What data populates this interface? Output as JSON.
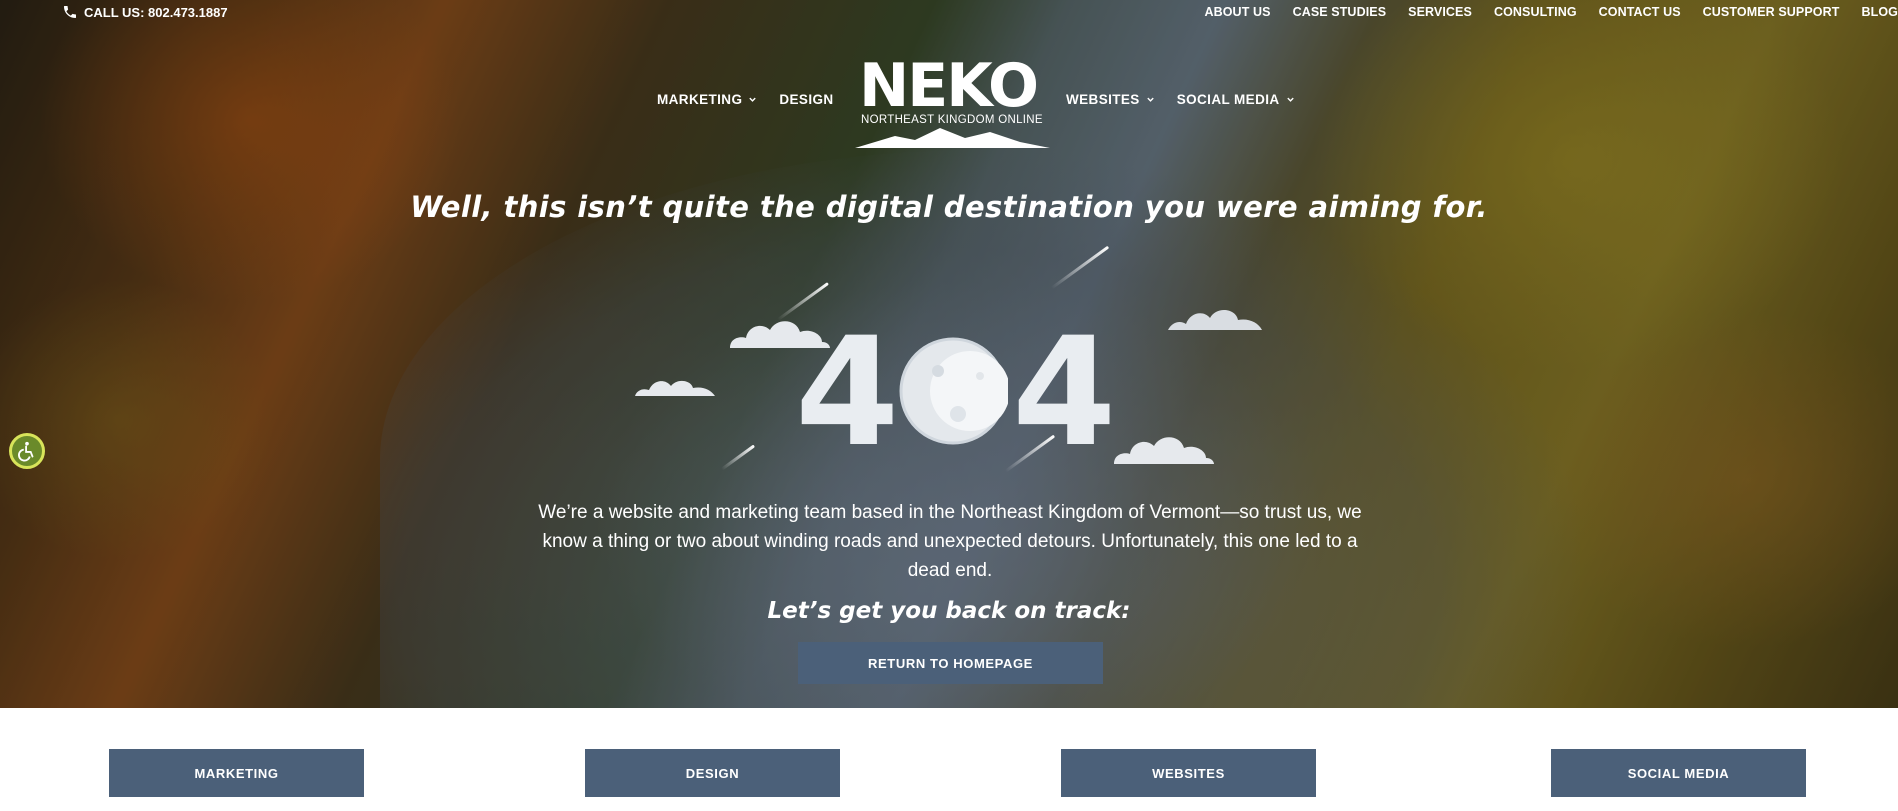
{
  "header": {
    "phone_label": "CALL US: 802.473.1887",
    "top_nav": [
      "ABOUT US",
      "CASE STUDIES",
      "SERVICES",
      "CONSULTING",
      "CONTACT US",
      "CUSTOMER SUPPORT",
      "BLOG"
    ],
    "main_nav_left": [
      {
        "label": "MARKETING",
        "has_dropdown": true
      },
      {
        "label": "DESIGN",
        "has_dropdown": false
      }
    ],
    "main_nav_right": [
      {
        "label": "WEBSITES",
        "has_dropdown": true
      },
      {
        "label": "SOCIAL MEDIA",
        "has_dropdown": true
      }
    ],
    "logo": {
      "word": "NEKO",
      "tagline": "NORTHEAST KINGDOM ONLINE"
    }
  },
  "hero": {
    "headline": "Well, this isn’t quite the digital destination you were aiming for.",
    "error_code": {
      "first": "4",
      "last": "4"
    },
    "description": "We’re a website and marketing team based in the Northeast Kingdom of Vermont—so trust us, we know a thing or two about winding roads and unexpected detours. Unfortunately, this one led to a dead end.",
    "subhead": "Let’s get you back on track:",
    "cta_label": "RETURN TO HOMEPAGE"
  },
  "bottom_buttons": [
    "MARKETING",
    "DESIGN",
    "WEBSITES",
    "SOCIAL MEDIA"
  ],
  "colors": {
    "button_bg": "#4b6079",
    "text": "#ffffff",
    "accessibility": "#6a8a2a"
  },
  "icons": {
    "phone": "phone-icon",
    "chevron": "chevron-down-icon",
    "accessibility": "wheelchair-icon",
    "moon": "moon-icon"
  }
}
